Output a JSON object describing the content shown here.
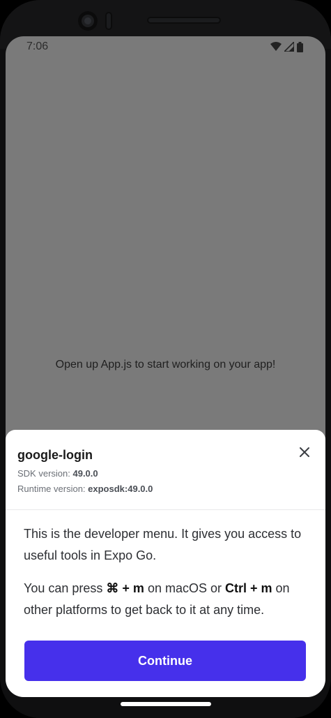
{
  "status_bar": {
    "time": "7:06",
    "icons": [
      "wifi-icon",
      "cellular-signal-icon",
      "battery-icon"
    ]
  },
  "app_content": {
    "message": "Open up App.js to start working on your app!"
  },
  "dev_menu": {
    "app_name": "google-login",
    "sdk_label": "SDK version: ",
    "sdk_value": "49.0.0",
    "runtime_label": "Runtime version: ",
    "runtime_value": "exposdk:49.0.0",
    "paragraph1": "This is the developer menu. It gives you access to useful tools in Expo Go.",
    "p2_a": "You can press ",
    "p2_key_mac": "⌘ + m",
    "p2_b": " on macOS or ",
    "p2_key_other": "Ctrl + m",
    "p2_c": " on other platforms to get back to it at any time.",
    "continue_label": "Continue",
    "close_icon": "close-icon"
  },
  "colors": {
    "accent": "#4630eb",
    "overlay": "#7a7a7a",
    "sheet_bg": "#ffffff"
  }
}
